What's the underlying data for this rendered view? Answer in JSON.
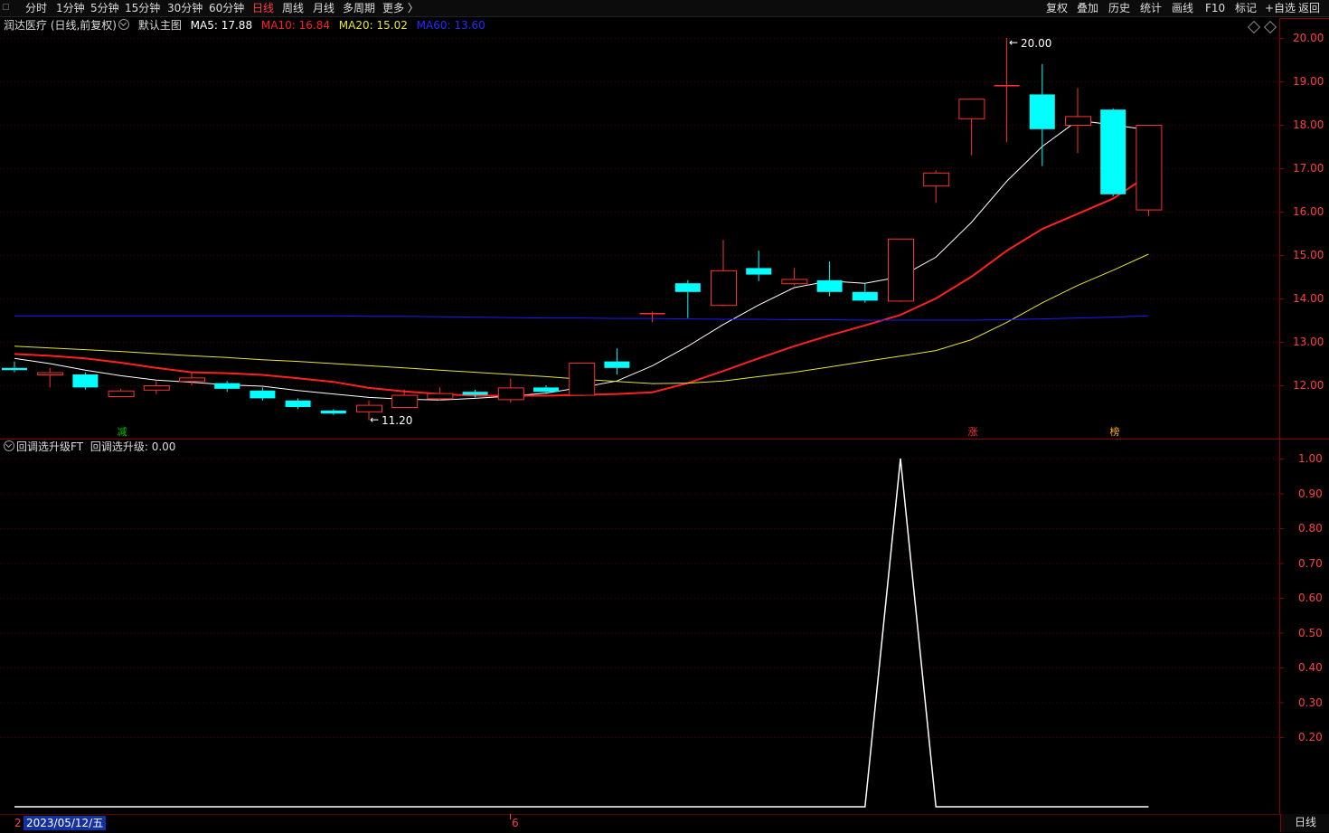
{
  "toolbar": {
    "timeframes": [
      "分时",
      "1分钟",
      "5分钟",
      "15分钟",
      "30分钟",
      "60分钟",
      "日线",
      "周线",
      "月线",
      "多周期",
      "更多 〉"
    ],
    "active_timeframe": "日线",
    "right_buttons": [
      "复权",
      "叠加",
      "历史",
      "统计",
      "画线",
      "F10",
      "标记",
      "+自选",
      "返回"
    ]
  },
  "main_legend": {
    "stock": "润达医疗 (日线,前复权)",
    "template": "默认主图",
    "ma5": "MA5: 17.88",
    "ma10": "MA10: 16.84",
    "ma20": "MA20: 15.02",
    "ma60": "MA60: 13.60"
  },
  "sub_legend": {
    "indicator": "回调选升级FT",
    "value": "回调选升级: 0.00"
  },
  "colors": {
    "up": "#ff3030",
    "down": "#00ffff",
    "ma5": "#ffffff",
    "ma10": "#ff2020",
    "ma20": "#e6e633",
    "ma60": "#1a1aff",
    "axis": "#8b0000"
  },
  "annotations": {
    "high": "20.00",
    "low": "11.20"
  },
  "markers": [
    {
      "text": "减",
      "color": "#00c000"
    },
    {
      "text": "涨",
      "color": "#ff3030"
    },
    {
      "text": "榜",
      "color": "#ffaa00"
    }
  ],
  "bottom": {
    "date": "2023/05/12/五",
    "left_tick": "2",
    "mid_tick": "6",
    "period": "日线"
  },
  "chart_data": [
    {
      "type": "candlestick",
      "y_ticks": [
        "20.00",
        "19.00",
        "18.00",
        "17.00",
        "16.00",
        "15.00",
        "14.00",
        "13.00",
        "12.00"
      ],
      "ylim": [
        11.0,
        20.5
      ],
      "candles": [
        {
          "o": 12.4,
          "c": 12.35,
          "h": 12.55,
          "l": 12.3
        },
        {
          "o": 12.25,
          "c": 12.3,
          "h": 12.4,
          "l": 11.95
        },
        {
          "o": 12.25,
          "c": 11.95,
          "h": 12.3,
          "l": 11.9
        },
        {
          "o": 11.75,
          "c": 11.88,
          "h": 11.92,
          "l": 11.75
        },
        {
          "o": 11.9,
          "c": 12.0,
          "h": 12.1,
          "l": 11.8
        },
        {
          "o": 12.1,
          "c": 12.18,
          "h": 12.3,
          "l": 12.0
        },
        {
          "o": 12.05,
          "c": 11.92,
          "h": 12.1,
          "l": 11.85
        },
        {
          "o": 11.88,
          "c": 11.7,
          "h": 11.95,
          "l": 11.65
        },
        {
          "o": 11.65,
          "c": 11.5,
          "h": 11.7,
          "l": 11.45
        },
        {
          "o": 11.42,
          "c": 11.35,
          "h": 11.45,
          "l": 11.32
        },
        {
          "o": 11.4,
          "c": 11.55,
          "h": 11.65,
          "l": 11.2
        },
        {
          "o": 11.5,
          "c": 11.78,
          "h": 11.9,
          "l": 11.5
        },
        {
          "o": 11.7,
          "c": 11.82,
          "h": 11.95,
          "l": 11.65
        },
        {
          "o": 11.85,
          "c": 11.78,
          "h": 11.9,
          "l": 11.72
        },
        {
          "o": 11.68,
          "c": 11.95,
          "h": 12.15,
          "l": 11.6
        },
        {
          "o": 11.95,
          "c": 11.85,
          "h": 12.0,
          "l": 11.8
        },
        {
          "o": 11.78,
          "c": 12.52,
          "h": 12.52,
          "l": 11.75
        },
        {
          "o": 12.55,
          "c": 12.4,
          "h": 12.85,
          "l": 12.25
        },
        {
          "o": 13.65,
          "c": 13.65,
          "h": 13.7,
          "l": 13.45
        },
        {
          "o": 14.35,
          "c": 14.15,
          "h": 14.42,
          "l": 13.55
        },
        {
          "o": 13.85,
          "c": 14.65,
          "h": 15.35,
          "l": 13.82
        },
        {
          "o": 14.7,
          "c": 14.55,
          "h": 15.1,
          "l": 14.4
        },
        {
          "o": 14.35,
          "c": 14.45,
          "h": 14.7,
          "l": 14.3
        },
        {
          "o": 14.42,
          "c": 14.15,
          "h": 14.85,
          "l": 14.05
        },
        {
          "o": 14.15,
          "c": 13.95,
          "h": 14.35,
          "l": 13.9
        },
        {
          "o": 13.95,
          "c": 15.38,
          "h": 15.38,
          "l": 13.92
        },
        {
          "o": 16.6,
          "c": 16.9,
          "h": 16.95,
          "l": 16.2
        },
        {
          "o": 18.15,
          "c": 18.6,
          "h": 18.6,
          "l": 17.3
        },
        {
          "o": 18.9,
          "c": 18.9,
          "h": 20.0,
          "l": 17.6
        },
        {
          "o": 18.7,
          "c": 17.9,
          "h": 19.4,
          "l": 17.05
        },
        {
          "o": 18.0,
          "c": 18.2,
          "h": 18.85,
          "l": 17.35
        },
        {
          "o": 18.35,
          "c": 16.4,
          "h": 18.38,
          "l": 16.35
        },
        {
          "o": 16.05,
          "c": 18.0,
          "h": 18.0,
          "l": 15.9
        }
      ],
      "series": [
        {
          "name": "MA5",
          "values": [
            12.62,
            12.5,
            12.35,
            12.22,
            12.12,
            12.07,
            12.01,
            11.98,
            11.88,
            11.8,
            11.72,
            11.68,
            11.66,
            11.7,
            11.75,
            11.82,
            11.95,
            12.1,
            12.45,
            12.9,
            13.4,
            13.85,
            14.25,
            14.4,
            14.35,
            14.5,
            14.95,
            15.75,
            16.7,
            17.5,
            18.1,
            18.0,
            17.88
          ]
        },
        {
          "name": "MA10",
          "values": [
            12.72,
            12.68,
            12.62,
            12.52,
            12.4,
            12.3,
            12.28,
            12.24,
            12.16,
            12.08,
            11.94,
            11.86,
            11.8,
            11.76,
            11.76,
            11.76,
            11.78,
            11.8,
            11.84,
            12.05,
            12.33,
            12.62,
            12.9,
            13.15,
            13.38,
            13.62,
            14.0,
            14.5,
            15.1,
            15.6,
            15.95,
            16.3,
            16.84
          ]
        },
        {
          "name": "MA20",
          "values": [
            12.9,
            12.86,
            12.82,
            12.78,
            12.73,
            12.68,
            12.64,
            12.59,
            12.55,
            12.5,
            12.45,
            12.4,
            12.35,
            12.3,
            12.25,
            12.2,
            12.14,
            12.09,
            12.04,
            12.05,
            12.1,
            12.2,
            12.3,
            12.42,
            12.55,
            12.67,
            12.8,
            13.05,
            13.45,
            13.9,
            14.3,
            14.65,
            15.02
          ]
        },
        {
          "name": "MA60",
          "values": [
            13.6,
            13.6,
            13.6,
            13.6,
            13.6,
            13.6,
            13.6,
            13.6,
            13.6,
            13.6,
            13.59,
            13.59,
            13.58,
            13.57,
            13.56,
            13.55,
            13.55,
            13.54,
            13.54,
            13.53,
            13.52,
            13.52,
            13.51,
            13.51,
            13.5,
            13.5,
            13.5,
            13.5,
            13.51,
            13.53,
            13.55,
            13.57,
            13.6
          ]
        }
      ]
    },
    {
      "type": "line",
      "name": "回调选升级",
      "y_ticks": [
        "1.00",
        "0.90",
        "0.80",
        "0.70",
        "0.60",
        "0.50",
        "0.40",
        "0.30",
        "0.20"
      ],
      "ylim": [
        0,
        1
      ],
      "values": [
        0,
        0,
        0,
        0,
        0,
        0,
        0,
        0,
        0,
        0,
        0,
        0,
        0,
        0,
        0,
        0,
        0,
        0,
        0,
        0,
        0,
        0,
        0,
        0,
        0,
        1,
        0,
        0,
        0,
        0,
        0,
        0,
        0
      ]
    }
  ]
}
